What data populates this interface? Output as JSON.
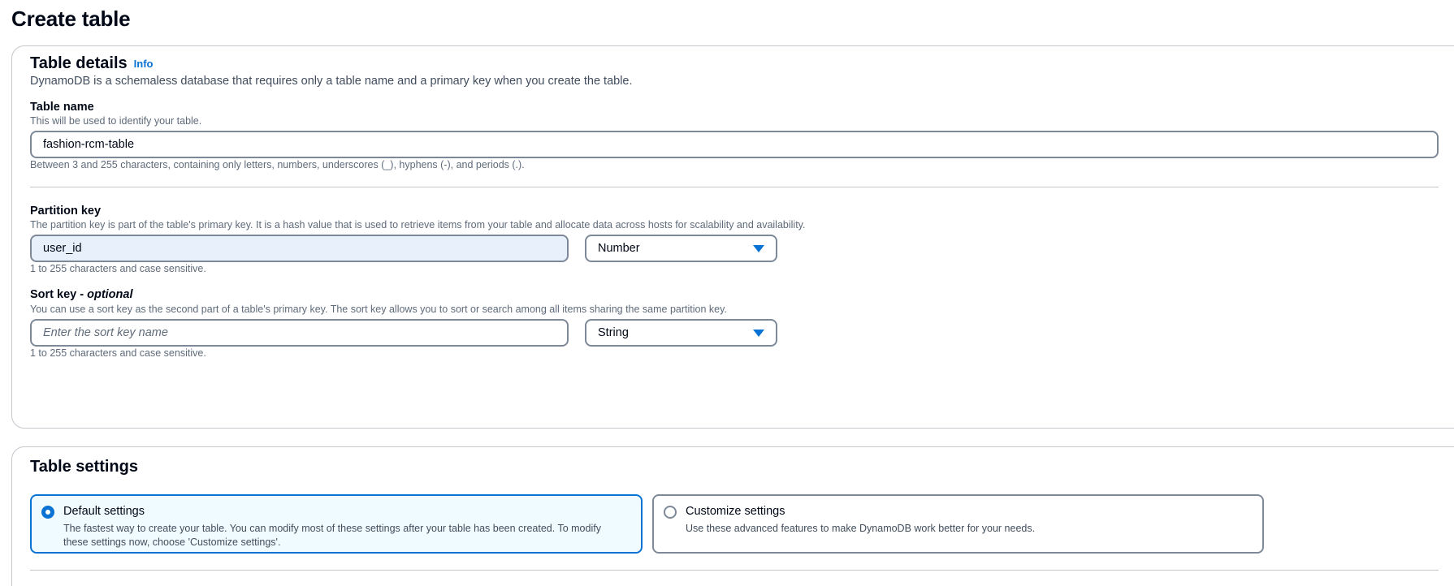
{
  "page": {
    "title": "Create table"
  },
  "table_details": {
    "heading": "Table details",
    "info": "Info",
    "description": "DynamoDB is a schemaless database that requires only a table name and a primary key when you create the table.",
    "table_name": {
      "label": "Table name",
      "description": "This will be used to identify your table.",
      "value": "fashion-rcm-table",
      "constraint": "Between 3 and 255 characters, containing only letters, numbers, underscores (_), hyphens (-), and periods (.)."
    },
    "partition_key": {
      "label": "Partition key",
      "description": "The partition key is part of the table's primary key. It is a hash value that is used to retrieve items from your table and allocate data across hosts for scalability and availability.",
      "value": "user_id",
      "type": "Number",
      "constraint": "1 to 255 characters and case sensitive."
    },
    "sort_key": {
      "label": "Sort key - ",
      "label_optional": "optional",
      "description": "You can use a sort key as the second part of a table's primary key. The sort key allows you to sort or search among all items sharing the same partition key.",
      "placeholder": "Enter the sort key name",
      "value": "",
      "type": "String",
      "constraint": "1 to 255 characters and case sensitive."
    }
  },
  "table_settings": {
    "heading": "Table settings",
    "options": [
      {
        "title": "Default settings",
        "description": "The fastest way to create your table. You can modify most of these settings after your table has been created. To modify these settings now, choose 'Customize settings'.",
        "selected": true
      },
      {
        "title": "Customize settings",
        "description": "Use these advanced features to make DynamoDB work better for your needs.",
        "selected": false
      }
    ]
  },
  "colors": {
    "accent": "#0972d3",
    "selected_tile_bg": "#f0fbff",
    "filled_input_bg": "#e8f0fb",
    "border": "#7d8998"
  },
  "icons": {
    "select_caret": "caret-down-icon",
    "radio": "radio-icon"
  }
}
